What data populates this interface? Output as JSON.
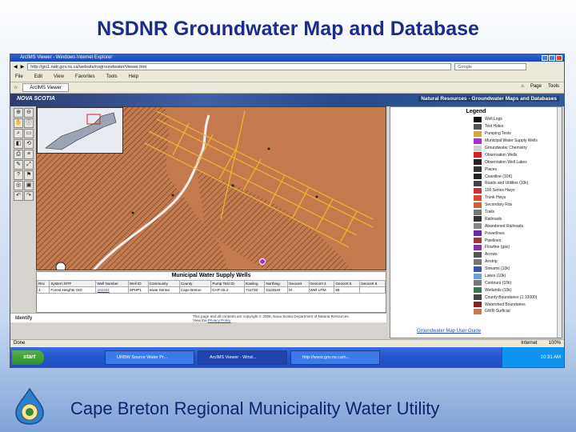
{
  "slide": {
    "title": "NSDNR Groundwater Map and Database",
    "subtitle": "Cape Breton Regional Municipality Water Utility"
  },
  "browser": {
    "window_title": "ArcIMS Viewer - Windows Internet Explorer",
    "address": "http://gis1.natr.gov.ns.ca/website/nsgroundwater/viewer.htm",
    "search_placeholder": "Google",
    "menu": [
      "File",
      "Edit",
      "View",
      "Favorites",
      "Tools",
      "Help"
    ],
    "tab_label": "ArcIMS Viewer",
    "right_tools": [
      "Page",
      "Tools"
    ],
    "status_left": "Done",
    "status_zone": "Internet",
    "zoom": "100%"
  },
  "banner": {
    "logo_text": "NOVA SCOTIA",
    "title": "Natural Resources - Groundwater Maps and Databases"
  },
  "tools": [
    "⊕",
    "⊖",
    "✋",
    "ⓘ",
    "⌕",
    "▭",
    "◧",
    "⟲",
    "⎙",
    "≡",
    "✎",
    "⤢",
    "?",
    "⚑",
    "◎",
    "▣",
    "↶",
    "↷"
  ],
  "legend": {
    "heading": "Legend",
    "items": [
      {
        "label": "Well Logs",
        "color": "#111111"
      },
      {
        "label": "Test Holes",
        "color": "#555555"
      },
      {
        "label": "Pumping Tests",
        "color": "#d4a640"
      },
      {
        "label": "Municipal Water Supply Wells",
        "color": "#b02ad8"
      },
      {
        "label": "Groundwater Chemistry",
        "color": "#d0d0d0"
      },
      {
        "label": "Observation Wells",
        "color": "#d22222"
      },
      {
        "label": "Observation Well Lakes",
        "color": "#222222"
      },
      {
        "label": "Places",
        "color": "#333333"
      },
      {
        "label": "Coastline (10K)",
        "color": "#222222"
      },
      {
        "label": "Roads and Utilities (10k)",
        "color": "#444444"
      },
      {
        "label": "100 Series Hwys",
        "color": "#d43030"
      },
      {
        "label": "Trunk Hwys",
        "color": "#d44a30"
      },
      {
        "label": "Secondary Rds",
        "color": "#d06030"
      },
      {
        "label": "Trails",
        "color": "#777777"
      },
      {
        "label": "Railroads",
        "color": "#333333"
      },
      {
        "label": "Abandoned Railroads",
        "color": "#888888"
      },
      {
        "label": "Powerlines",
        "color": "#6b2aa8"
      },
      {
        "label": "Pipelines",
        "color": "#aa3333"
      },
      {
        "label": "Flowline (gas)",
        "color": "#7a3aa0"
      },
      {
        "label": "Arrows",
        "color": "#555555"
      },
      {
        "label": "Airstrip",
        "color": "#777777"
      },
      {
        "label": "Streams (10k)",
        "color": "#3355aa"
      },
      {
        "label": "Lakes (10k)",
        "color": "#6fa0d8"
      },
      {
        "label": "Contours (10k)",
        "color": "#777777"
      },
      {
        "label": "Wetlands (10k)",
        "color": "#3a7a4a"
      },
      {
        "label": "County Boundaries (1:10000)",
        "color": "#444444"
      },
      {
        "label": "Watershed Boundaries",
        "color": "#8a2222"
      },
      {
        "label": "GWR-Surficial",
        "color": "#c57a4e"
      }
    ]
  },
  "wells_table": {
    "title": "Municipal Water Supply Wells",
    "headers": [
      "Rec",
      "System MTF",
      "Well Number",
      "Well ID",
      "Community",
      "County",
      "Pump Test ID",
      "Easting",
      "Northing",
      "Geocert",
      "Geocert 4",
      "Geocert 5",
      "Geocert 6"
    ],
    "rows": [
      [
        "1",
        "Forest Heights GID",
        "202404",
        "SPHP1",
        "Iowie Sentar",
        "Cape Breton",
        "CAP-45.2",
        "711730",
        "5124520",
        "M",
        "Well UTM",
        "58",
        ""
      ]
    ]
  },
  "footer": {
    "identify": "Identify",
    "copyright": "This page and all contents are copyright © 2005, Nova Scotia Department of Natural Resources.",
    "view_policy": "View the",
    "privacy": "Privacy Policy",
    "user_guide": "Groundwater Map User Guide"
  },
  "taskbar": {
    "start": "start",
    "buttons": [
      "URBW Source Water Pr...",
      "ArcIMS Viewer - Wind...",
      "http://www.gov.ns.ca/n..."
    ],
    "clock": "10:31 AM"
  },
  "colors": {
    "title": "#1a2c8c",
    "map_background": "#c57a4e",
    "road_yellow": "#f2b630"
  }
}
